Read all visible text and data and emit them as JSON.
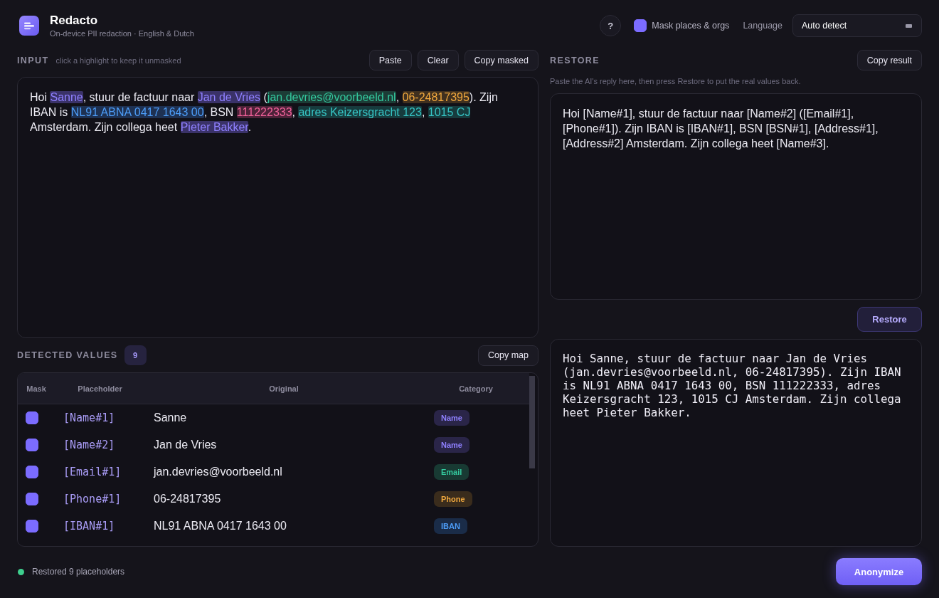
{
  "app": {
    "title": "Redacto",
    "subtitle": "On-device PII redaction · English & Dutch"
  },
  "toolbar": {
    "help_button": "?",
    "mask_option": {
      "label": "Mask places & orgs",
      "checked": true
    },
    "language": {
      "label": "Language",
      "value": "Auto detect"
    }
  },
  "input": {
    "heading": "INPUT",
    "hint": "click a highlight to keep it unmasked",
    "buttons": [
      "Paste",
      "Clear",
      "Copy masked"
    ],
    "segments": [
      {
        "kind": "plain",
        "text": "Hoi "
      },
      {
        "kind": "name",
        "text": "Sanne"
      },
      {
        "kind": "plain",
        "text": ", stuur de factuur naar "
      },
      {
        "kind": "name",
        "text": "Jan de Vries"
      },
      {
        "kind": "plain",
        "text": " ("
      },
      {
        "kind": "email",
        "text": "jan.devries@voorbeeld.nl"
      },
      {
        "kind": "plain",
        "text": ", "
      },
      {
        "kind": "phone",
        "text": "06-24817395"
      },
      {
        "kind": "plain",
        "text": "). Zijn IBAN is "
      },
      {
        "kind": "iban",
        "text": "NL91 ABNA 0417 1643 00"
      },
      {
        "kind": "plain",
        "text": ", BSN "
      },
      {
        "kind": "bsn",
        "text": "111222333"
      },
      {
        "kind": "plain",
        "text": ", "
      },
      {
        "kind": "address",
        "text": "adres Keizersgracht 123"
      },
      {
        "kind": "plain",
        "text": ", "
      },
      {
        "kind": "address",
        "text": "1015 CJ"
      },
      {
        "kind": "plain",
        "text": " Amsterdam. Zijn collega heet "
      },
      {
        "kind": "name",
        "text": "Pieter Bakker"
      },
      {
        "kind": "plain",
        "text": "."
      }
    ]
  },
  "detected": {
    "heading": "DETECTED VALUES",
    "count": "9",
    "button": "Copy map",
    "columns": [
      "Mask",
      "Placeholder",
      "Original",
      "Category"
    ],
    "rows": [
      {
        "checked": true,
        "placeholder": "[Name#1]",
        "original": "Sanne",
        "category": "Name",
        "kind": "name"
      },
      {
        "checked": true,
        "placeholder": "[Name#2]",
        "original": "Jan de Vries",
        "category": "Name",
        "kind": "name"
      },
      {
        "checked": true,
        "placeholder": "[Email#1]",
        "original": "jan.devries@voorbeeld.nl",
        "category": "Email",
        "kind": "email"
      },
      {
        "checked": true,
        "placeholder": "[Phone#1]",
        "original": "06-24817395",
        "category": "Phone",
        "kind": "phone"
      },
      {
        "checked": true,
        "placeholder": "[IBAN#1]",
        "original": "NL91 ABNA 0417 1643 00",
        "category": "IBAN",
        "kind": "iban"
      }
    ]
  },
  "restore": {
    "heading": "RESTORE",
    "button": "Copy result",
    "hint": "Paste the AI's reply here, then press Restore to put the real values back.",
    "reply_text": "Hoi [Name#1], stuur de factuur naar [Name#2] ([Email#1], [Phone#1]). Zijn IBAN is [IBAN#1], BSN [BSN#1], [Address#1], [Address#2] Amsterdam. Zijn collega heet [Name#3].",
    "restore_button": "Restore",
    "output_text": "Hoi Sanne, stuur de factuur naar Jan de Vries (jan.devries@voorbeeld.nl, 06-24817395). Zijn IBAN is NL91 ABNA 0417 1643 00, BSN 111222333, adres Keizersgracht 123, 1015 CJ Amsterdam. Zijn collega heet Pieter Bakker."
  },
  "status": {
    "kind": "success",
    "text": "Restored 9 placeholders"
  },
  "primary_button": "Anonymize"
}
